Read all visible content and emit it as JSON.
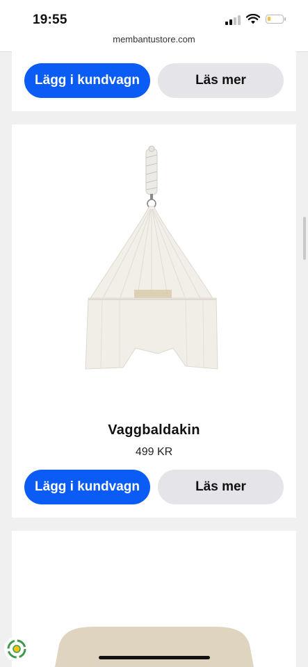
{
  "status_bar": {
    "time": "19:55"
  },
  "browser": {
    "url": "membantustore.com"
  },
  "card_top": {
    "add_to_cart_label": "Lägg i kundvagn",
    "read_more_label": "Läs mer"
  },
  "product": {
    "name": "Vaggbaldakin",
    "price": "499 KR",
    "add_to_cart_label": "Lägg i kundvagn",
    "read_more_label": "Läs mer"
  },
  "colors": {
    "primary_button": "#0a5cf5",
    "secondary_button": "#e4e4e9",
    "page_background": "#f0f0f0",
    "battery_low": "#f3c13a"
  },
  "icons": [
    "signal-icon",
    "wifi-icon",
    "battery-icon",
    "recycle-badge-icon"
  ]
}
